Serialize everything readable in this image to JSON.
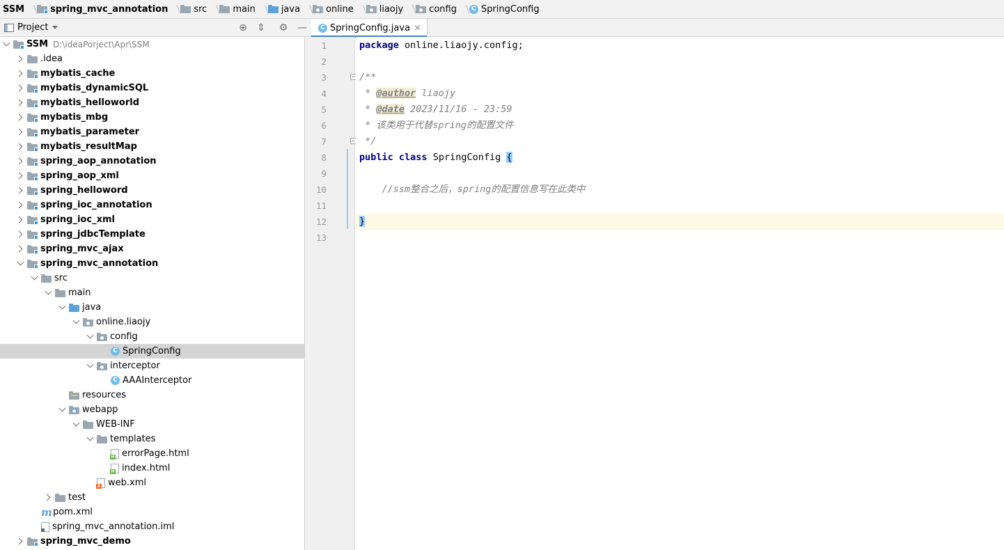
{
  "breadcrumb": [
    {
      "label": "SSM",
      "icon": "none",
      "bold": true
    },
    {
      "label": "spring_mvc_annotation",
      "icon": "module-folder-icon",
      "bold": true
    },
    {
      "label": "src",
      "icon": "folder-icon",
      "bold": false
    },
    {
      "label": "main",
      "icon": "folder-icon",
      "bold": false
    },
    {
      "label": "java",
      "icon": "source-folder-icon",
      "bold": false
    },
    {
      "label": "online",
      "icon": "package-icon",
      "bold": false
    },
    {
      "label": "liaojy",
      "icon": "package-icon",
      "bold": false
    },
    {
      "label": "config",
      "icon": "package-icon",
      "bold": false
    },
    {
      "label": "SpringConfig",
      "icon": "class-icon",
      "bold": false
    }
  ],
  "project_panel": {
    "title": "Project",
    "buttons": [
      "locate-icon",
      "collapse-all-icon",
      "gear-icon",
      "minimize-icon"
    ]
  },
  "tree": [
    {
      "label": "SSM",
      "path": "D:\\ideaPorject\\Apr\\SSM",
      "indent": 0,
      "arrow": "down",
      "icon": "module",
      "bold": true
    },
    {
      "label": ".idea",
      "indent": 1,
      "arrow": "right",
      "icon": "folder",
      "bold": false
    },
    {
      "label": "mybatis_cache",
      "indent": 1,
      "arrow": "right",
      "icon": "module",
      "bold": true
    },
    {
      "label": "mybatis_dynamicSQL",
      "indent": 1,
      "arrow": "right",
      "icon": "module",
      "bold": true
    },
    {
      "label": "mybatis_helloworld",
      "indent": 1,
      "arrow": "right",
      "icon": "module",
      "bold": true
    },
    {
      "label": "mybatis_mbg",
      "indent": 1,
      "arrow": "right",
      "icon": "module",
      "bold": true
    },
    {
      "label": "mybatis_parameter",
      "indent": 1,
      "arrow": "right",
      "icon": "module",
      "bold": true
    },
    {
      "label": "mybatis_resultMap",
      "indent": 1,
      "arrow": "right",
      "icon": "module",
      "bold": true
    },
    {
      "label": "spring_aop_annotation",
      "indent": 1,
      "arrow": "right",
      "icon": "module",
      "bold": true
    },
    {
      "label": "spring_aop_xml",
      "indent": 1,
      "arrow": "right",
      "icon": "module",
      "bold": true
    },
    {
      "label": "spring_helloword",
      "indent": 1,
      "arrow": "right",
      "icon": "module",
      "bold": true
    },
    {
      "label": "spring_ioc_annotation",
      "indent": 1,
      "arrow": "right",
      "icon": "module",
      "bold": true
    },
    {
      "label": "spring_ioc_xml",
      "indent": 1,
      "arrow": "right",
      "icon": "module",
      "bold": true
    },
    {
      "label": "spring_jdbcTemplate",
      "indent": 1,
      "arrow": "right",
      "icon": "module",
      "bold": true
    },
    {
      "label": "spring_mvc_ajax",
      "indent": 1,
      "arrow": "right",
      "icon": "module",
      "bold": true
    },
    {
      "label": "spring_mvc_annotation",
      "indent": 1,
      "arrow": "down",
      "icon": "module",
      "bold": true
    },
    {
      "label": "src",
      "indent": 2,
      "arrow": "down",
      "icon": "folder",
      "bold": false
    },
    {
      "label": "main",
      "indent": 3,
      "arrow": "down",
      "icon": "folder",
      "bold": false
    },
    {
      "label": "java",
      "indent": 4,
      "arrow": "down",
      "icon": "source",
      "bold": false
    },
    {
      "label": "online.liaojy",
      "indent": 5,
      "arrow": "down",
      "icon": "package",
      "bold": false
    },
    {
      "label": "config",
      "indent": 6,
      "arrow": "down",
      "icon": "package",
      "bold": false
    },
    {
      "label": "SpringConfig",
      "indent": 7,
      "arrow": "none",
      "icon": "class",
      "bold": false,
      "selected": true
    },
    {
      "label": "interceptor",
      "indent": 6,
      "arrow": "down",
      "icon": "package",
      "bold": false
    },
    {
      "label": "AAAInterceptor",
      "indent": 7,
      "arrow": "none",
      "icon": "class",
      "bold": false
    },
    {
      "label": "resources",
      "indent": 4,
      "arrow": "none",
      "icon": "resources",
      "bold": false
    },
    {
      "label": "webapp",
      "indent": 4,
      "arrow": "down",
      "icon": "web",
      "bold": false
    },
    {
      "label": "WEB-INF",
      "indent": 5,
      "arrow": "down",
      "icon": "folder",
      "bold": false
    },
    {
      "label": "templates",
      "indent": 6,
      "arrow": "down",
      "icon": "folder",
      "bold": false
    },
    {
      "label": "errorPage.html",
      "indent": 7,
      "arrow": "none",
      "icon": "html",
      "bold": false
    },
    {
      "label": "index.html",
      "indent": 7,
      "arrow": "none",
      "icon": "html",
      "bold": false
    },
    {
      "label": "web.xml",
      "indent": 6,
      "arrow": "none",
      "icon": "xml",
      "bold": false
    },
    {
      "label": "test",
      "indent": 3,
      "arrow": "right",
      "icon": "folder",
      "bold": false
    },
    {
      "label": "pom.xml",
      "indent": 2,
      "arrow": "none",
      "icon": "maven",
      "bold": false
    },
    {
      "label": "spring_mvc_annotation.iml",
      "indent": 2,
      "arrow": "none",
      "icon": "iml",
      "bold": false
    },
    {
      "label": "spring_mvc_demo",
      "indent": 1,
      "arrow": "right",
      "icon": "module",
      "bold": true
    }
  ],
  "editor": {
    "tab_label": "SpringConfig.java",
    "tab_close": "×",
    "current_line": 12,
    "lines": [
      {
        "n": "1",
        "tokens": [
          {
            "t": "package",
            "c": "kw"
          },
          {
            "t": " online.liaojy.config;",
            "c": ""
          }
        ]
      },
      {
        "n": "2",
        "tokens": []
      },
      {
        "n": "3",
        "tokens": [
          {
            "t": "/**",
            "c": "cm"
          }
        ],
        "fold": true
      },
      {
        "n": "4",
        "tokens": [
          {
            "t": " * ",
            "c": "cm"
          },
          {
            "t": "@author",
            "c": "tag"
          },
          {
            "t": " liaojy",
            "c": "cm"
          }
        ]
      },
      {
        "n": "5",
        "tokens": [
          {
            "t": " * ",
            "c": "cm"
          },
          {
            "t": "@date",
            "c": "tag"
          },
          {
            "t": " 2023/11/16 - 23:59",
            "c": "cm"
          }
        ]
      },
      {
        "n": "6",
        "tokens": [
          {
            "t": " * 该类用于代替spring的配置文件",
            "c": "cm"
          }
        ]
      },
      {
        "n": "7",
        "tokens": [
          {
            "t": " */",
            "c": "cm"
          }
        ],
        "fold": true
      },
      {
        "n": "8",
        "tokens": [
          {
            "t": "public",
            "c": "kw"
          },
          {
            "t": " ",
            "c": ""
          },
          {
            "t": "class",
            "c": "kw"
          },
          {
            "t": " SpringConfig ",
            "c": "cls-name"
          },
          {
            "t": "{",
            "c": "brace"
          }
        ]
      },
      {
        "n": "9",
        "tokens": []
      },
      {
        "n": "10",
        "tokens": [
          {
            "t": "    //ssm整合之后，spring的配置信息写在此类中",
            "c": "lc"
          }
        ]
      },
      {
        "n": "11",
        "tokens": []
      },
      {
        "n": "12",
        "tokens": [
          {
            "t": "}",
            "c": "brace2"
          }
        ]
      },
      {
        "n": "13",
        "tokens": []
      }
    ]
  }
}
